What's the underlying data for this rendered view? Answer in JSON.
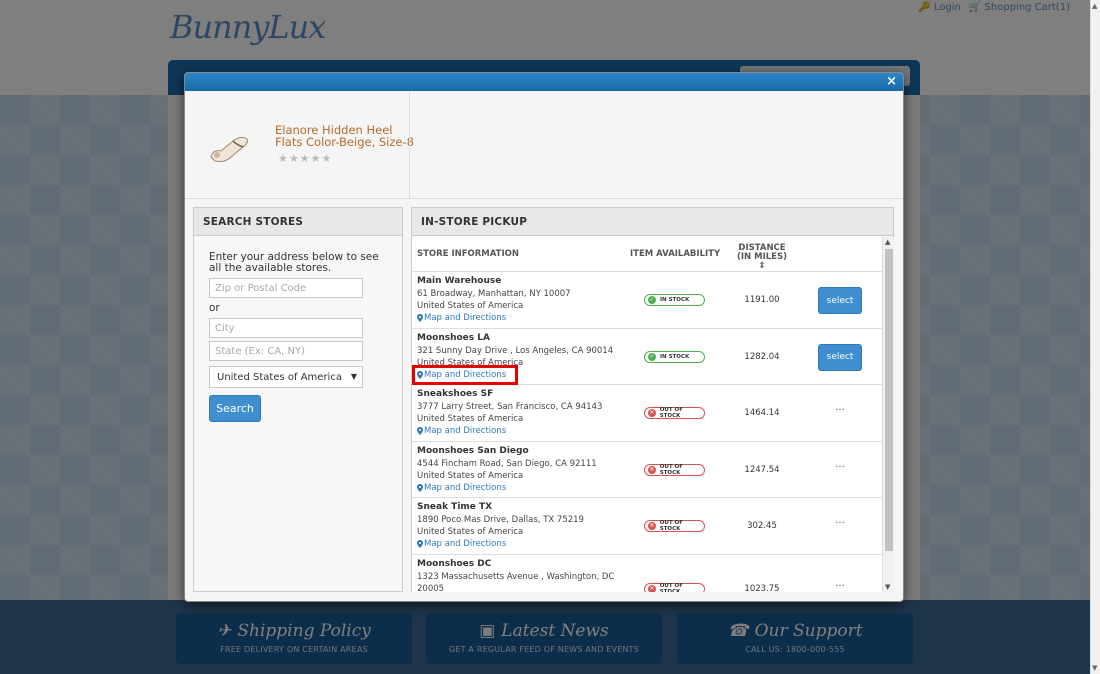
{
  "site": {
    "logo": "BunnyLux",
    "login": "Login",
    "cart": "Shopping Cart(1)"
  },
  "footer": [
    {
      "title": "Shipping Policy",
      "subtitle": "FREE DELIVERY ON CERTAIN AREAS",
      "icon": "plane-icon"
    },
    {
      "title": "Latest News",
      "subtitle": "GET A REGULAR FEED OF NEWS AND EVENTS",
      "icon": "rss-icon"
    },
    {
      "title": "Our Support",
      "subtitle": "CALL US: 1800-000-555",
      "icon": "phone-icon"
    }
  ],
  "modal": {
    "close": "×",
    "product": {
      "title": "Elanore Hidden Heel Flats Color-Beige, Size-8",
      "rating": 0
    },
    "search": {
      "heading": "SEARCH STORES",
      "intro": "Enter your address below to see all the available stores.",
      "zip_placeholder": "Zip or Postal Code",
      "or": "or",
      "city_placeholder": "City",
      "state_placeholder": "State (Ex: CA, NY)",
      "country": "United States of America",
      "button": "Search"
    },
    "pickup": {
      "heading": "IN-STORE PICKUP",
      "col_store": "STORE INFORMATION",
      "col_availability": "ITEM AVAILABILITY",
      "col_distance_1": "DISTANCE",
      "col_distance_2": "(IN MILES)",
      "map_label": "Map and Directions",
      "select_label": "select",
      "no_action": "···",
      "stores": [
        {
          "name": "Main Warehouse",
          "address": "61 Broadway, Manhattan, NY 10007",
          "country": "United States of America",
          "status": "IN STOCK",
          "distance": "1191.00",
          "in_stock": true
        },
        {
          "name": "Moonshoes LA",
          "address": "321 Sunny Day Drive , Los Angeles, CA 90014",
          "country": "United States of America",
          "status": "IN STOCK",
          "distance": "1282.04",
          "in_stock": true
        },
        {
          "name": "Sneakshoes SF",
          "address": "3777 Larry Street, San Francisco, CA 94143",
          "country": "United States of America",
          "status": "OUT OF STOCK",
          "distance": "1464.14",
          "in_stock": false
        },
        {
          "name": "Moonshoes San Diego",
          "address": "4544 Fincham Road, San Diego, CA 92111",
          "country": "United States of America",
          "status": "OUT OF STOCK",
          "distance": "1247.54",
          "in_stock": false
        },
        {
          "name": "Sneak Time TX",
          "address": "1890 Poco Mas Drive, Dallas, TX 75219",
          "country": "United States of America",
          "status": "OUT OF STOCK",
          "distance": "302.45",
          "in_stock": false
        },
        {
          "name": "Moonshoes DC",
          "address": "1323 Massachusetts Avenue , Washington, DC",
          "country": "20005",
          "status": "OUT OF STOCK",
          "distance": "1023.75",
          "in_stock": false
        }
      ]
    }
  },
  "colors": {
    "accent": "#3f8fd0",
    "in_stock": "#4caf50",
    "out_of_stock": "#d9534f",
    "highlight": "#e60000",
    "product_title": "#b86a2c"
  }
}
